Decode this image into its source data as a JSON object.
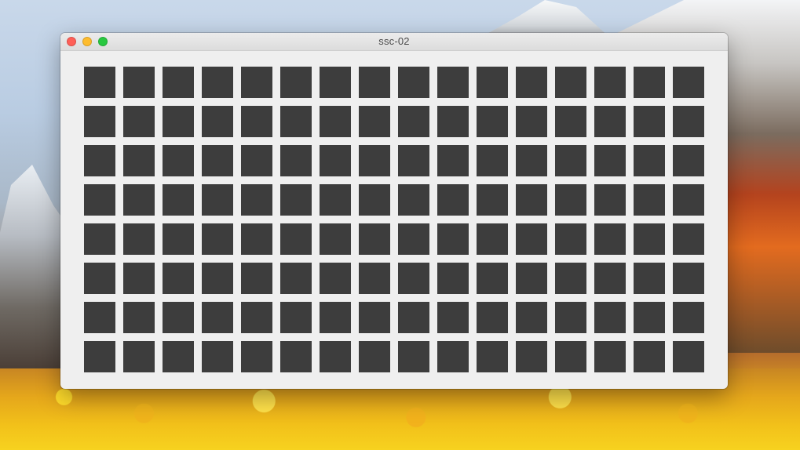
{
  "window": {
    "title": "ssc-02"
  },
  "grid": {
    "rows": 8,
    "columns": 16,
    "cell_color": "#3d3d3d",
    "background_color": "#efefef"
  },
  "traffic_lights": {
    "close": "#ff5f57",
    "minimize": "#febc2e",
    "zoom": "#28c840"
  }
}
